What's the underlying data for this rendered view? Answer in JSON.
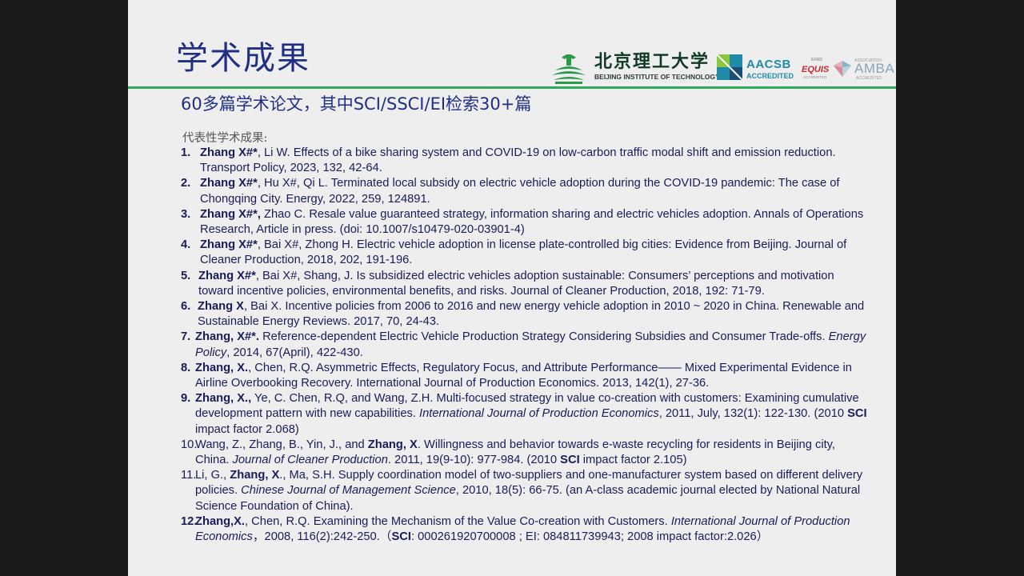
{
  "slide": {
    "title": "学术成果",
    "subtitle": "60多篇学术论文，其中SCI/SSCI/EI检索30+篇",
    "intro_label": "代表性学术成果:"
  },
  "logos": {
    "bit_cn": "北京理工大学",
    "bit_en": "BEIJING INSTITUTE OF TECHNOLOGY",
    "aacsb_name": "AACSB",
    "aacsb_sub": "ACCREDITED",
    "efmd": "EFMD",
    "equis": "EQUIS",
    "equis_sub": "ACCREDITED",
    "amba_small": "ASSOCIATION",
    "amba_name": "AMBA",
    "amba_sub": "ACCREDITED"
  },
  "colors": {
    "title": "#1f2f86",
    "rule": "#2daa5a",
    "body_text": "#1b1b5a",
    "aacsb": "#1f8ba8",
    "equis": "#c62a2f"
  },
  "publications": [
    {
      "num": "1.",
      "num_bold": true,
      "indent": 24,
      "parts": [
        {
          "t": "Zhang X#*",
          "b": true
        },
        {
          "t": ", Li W. Effects of a bike sharing system and COVID-19 on low-carbon traffic modal shift and emission reduction. Transport Policy, 2023, 132, 42-64."
        }
      ]
    },
    {
      "num": "2.",
      "num_bold": true,
      "indent": 24,
      "parts": [
        {
          "t": "Zhang X#*",
          "b": true
        },
        {
          "t": ", Hu X#, Qi L. Terminated local subsidy on electric vehicle adoption during the COVID-19 pandemic: The case of Chongqing City. Energy, 2022, 259, 124891."
        }
      ]
    },
    {
      "num": "3.",
      "num_bold": true,
      "indent": 24,
      "parts": [
        {
          "t": "Zhang X#*,",
          "b": true
        },
        {
          "t": " Zhao C. Resale value guaranteed strategy, information sharing and electric vehicles adoption. Annals of Operations Research, Article in press. (doi: 10.1007/s10479-020-03901-4)"
        }
      ]
    },
    {
      "num": "4.",
      "num_bold": true,
      "indent": 24,
      "parts": [
        {
          "t": "Zhang X#*",
          "b": true
        },
        {
          "t": ", Bai X#, Zhong H. Electric vehicle adoption in license plate-controlled big cities: Evidence from Beijing. Journal of Cleaner Production, 2018, 202, 191-196."
        }
      ]
    },
    {
      "num": "5.",
      "num_bold": true,
      "indent": 22,
      "parts": [
        {
          "t": "Zhang X#*",
          "b": true
        },
        {
          "t": ", Bai X#, Shang, J. Is subsidized electric vehicles adoption sustainable: Consumers’ perceptions and motivation toward incentive policies, environmental benefits, and risks. Journal of Cleaner Production, 2018, 192: 71-79."
        }
      ]
    },
    {
      "num": "6.",
      "num_bold": true,
      "indent": 21,
      "parts": [
        {
          "t": "Zhang X",
          "b": true
        },
        {
          "t": ", Bai X. Incentive policies from 2006 to 2016 and new energy vehicle adoption in 2010 ~ 2020 in China. Renewable and Sustainable Energy Reviews. 2017, 70, 24-43."
        }
      ]
    },
    {
      "num": "7.",
      "num_bold": true,
      "indent": 18,
      "parts": [
        {
          "t": "Zhang, X#*.",
          "b": true
        },
        {
          "t": " Reference-dependent Electric Vehicle Production Strategy Considering Subsidies and Consumer Trade-offs. "
        },
        {
          "t": "Energy Policy",
          "i": true
        },
        {
          "t": ", 2014, 67(April), 422-430."
        }
      ]
    },
    {
      "num": "8.",
      "num_bold": true,
      "indent": 18,
      "parts": [
        {
          "t": "Zhang, X.",
          "b": true
        },
        {
          "t": ", Chen, R.Q. Asymmetric Effects, Regulatory Focus, and Attribute Performance—— Mixed Experimental Evidence in Airline Overbooking Recovery. International Journal of Production Economics. 2013, 142(1), 27-36."
        }
      ]
    },
    {
      "num": "9.",
      "num_bold": true,
      "indent": 18,
      "parts": [
        {
          "t": "Zhang, X.,",
          "b": true
        },
        {
          "t": " Ye, C. Chen, R.Q, and Wang, Z.H. Multi-focused strategy in value co-creation with customers: Examining cumulative development pattern with new capabilities. "
        },
        {
          "t": "International Journal of Production Economics",
          "i": true
        },
        {
          "t": ", 2011, July, 132(1): 122-130. (2010 "
        },
        {
          "t": "SCI",
          "b": true
        },
        {
          "t": " impact factor 2.068)"
        }
      ]
    },
    {
      "num": "10.",
      "num_bold": false,
      "indent": 18,
      "parts": [
        {
          "t": "Wang, Z., Zhang, B., Yin, J., and "
        },
        {
          "t": "Zhang, X",
          "b": true
        },
        {
          "t": ". Willingness and behavior towards e-waste recycling for residents in Beijing city, China. "
        },
        {
          "t": "Journal of Cleaner Production",
          "i": true
        },
        {
          "t": ". 2011, 19(9-10): 977-984. (2010 "
        },
        {
          "t": "SCI",
          "b": true
        },
        {
          "t": " impact factor 2.105)"
        }
      ]
    },
    {
      "num": "11.",
      "num_bold": false,
      "indent": 18,
      "parts": [
        {
          "t": "Li, G., "
        },
        {
          "t": "Zhang, X",
          "b": true
        },
        {
          "t": "., Ma, S.H. Supply coordination model of two-suppliers and one-manufacturer system based on different delivery policies. "
        },
        {
          "t": "Chinese Journal of Management Science",
          "i": true
        },
        {
          "t": ", 2010, 18(5): 66-75. (an A-class academic journal elected by National Natural Science Foundation of China)."
        }
      ]
    },
    {
      "num": "12.",
      "num_bold": true,
      "indent": 18,
      "parts": [
        {
          "t": "Zhang,X.",
          "b": true
        },
        {
          "t": ", Chen, R.Q. Examining the Mechanism of the Value Co-creation with Customers. "
        },
        {
          "t": "International Journal of Production Economics",
          "i": true
        },
        {
          "t": "，2008, 116(2):242-250.（"
        },
        {
          "t": "SCI",
          "b": true
        },
        {
          "t": ": 000261920700008 ; EI: 084811739943; 2008 impact factor:2.026）"
        }
      ]
    }
  ]
}
